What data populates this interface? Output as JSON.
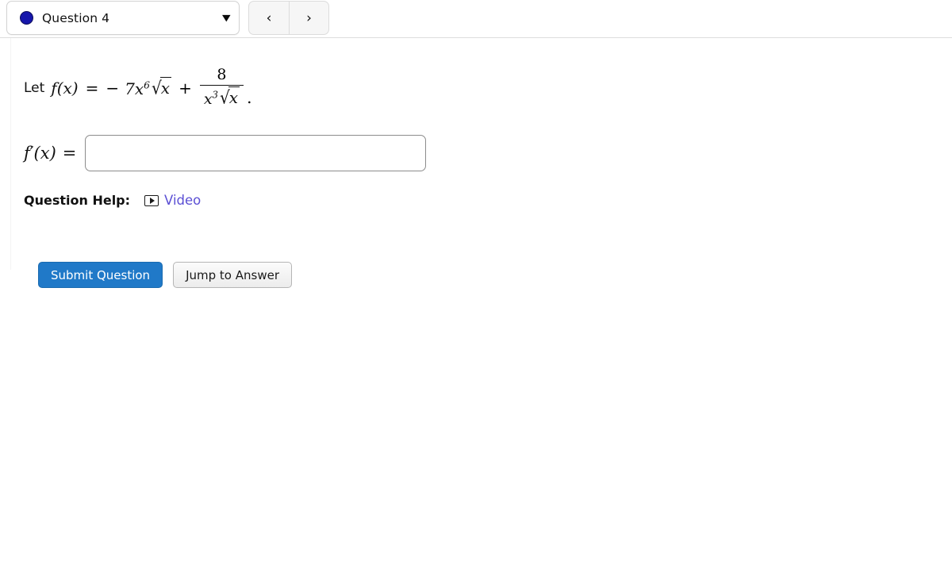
{
  "topbar": {
    "question_select": {
      "label": "Question 4",
      "dot_color": "#1616ab",
      "caret": "▼"
    },
    "nav": {
      "prev_label": "‹",
      "next_label": "›"
    }
  },
  "question": {
    "statement": {
      "lead": "Let",
      "fn": "f(x)",
      "equals": "=",
      "minus": "−",
      "coefficient": "7x",
      "coefficient_exponent": "6",
      "radicand": "x",
      "radical_sign": "√",
      "plus": "+",
      "fraction": {
        "numerator": "8",
        "denominator_base": "x",
        "denominator_exponent": "3",
        "denominator_radicand": "x"
      },
      "period": "."
    },
    "answer": {
      "label_fn": "f′(x)",
      "label_equals": "=",
      "input_value": "",
      "input_placeholder": ""
    },
    "help": {
      "label": "Question Help:",
      "video_label": "Video",
      "video_icon": "video-play-icon",
      "link_color": "#5b4fd4"
    },
    "buttons": {
      "submit_label": "Submit Question",
      "submit_color": "#2079c8",
      "jump_label": "Jump to Answer"
    }
  }
}
